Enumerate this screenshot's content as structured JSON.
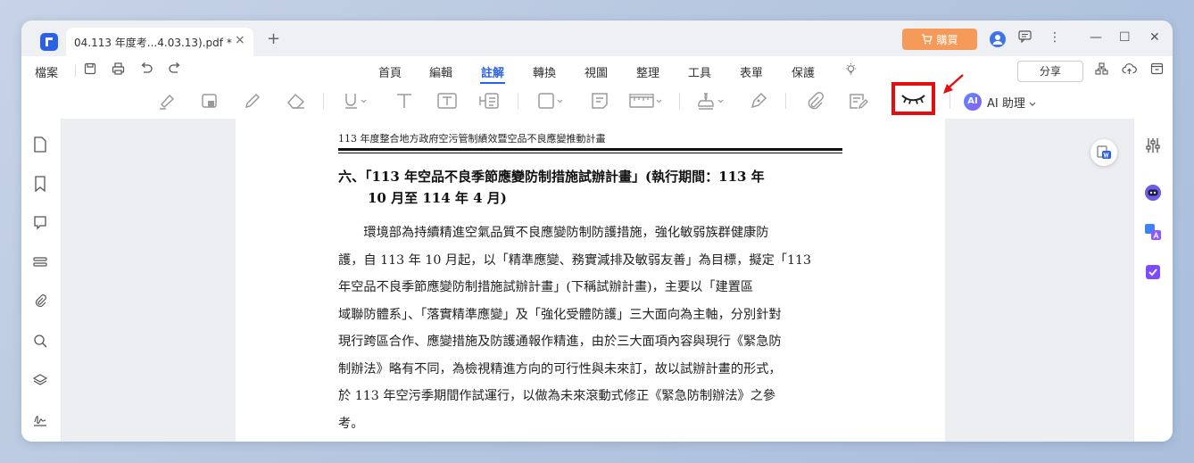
{
  "tab": {
    "title": "04.113 年度考...4.03.13).pdf *",
    "close": "×",
    "new": "+"
  },
  "titlebar": {
    "buy": "購買",
    "account_initial": "",
    "min": "—",
    "max": "☐",
    "close": "✕",
    "chat": "☰",
    "more": "⋮"
  },
  "menubar": {
    "file": "檔案",
    "items": [
      "首頁",
      "編輯",
      "註解",
      "轉換",
      "視圖",
      "整理",
      "工具",
      "表單",
      "保護"
    ],
    "active": "註解",
    "share": "分享"
  },
  "toolbar": {
    "ai_label": "AI 助理",
    "ai_icon_text": "AI",
    "highlight_color": "#e30e0e",
    "accent": "#2a61e8"
  },
  "page": {
    "header": "113 年度整合地方政府空污管制績效暨空品不良應變推動計畫",
    "heading_line1": "六、「113 年空品不良季節應變防制措施試辦計畫」(執行期間：113 年",
    "heading_line2": "10 月至 114 年 4 月)",
    "body_lines": [
      "　　環境部為持續精進空氣品質不良應變防制防護措施，強化敏弱族群健康防",
      "護，自 113 年 10 月起，以「精準應變、務實減排及敏弱友善」為目標，擬定「113",
      "年空品不良季節應變防制措施試辦計畫」(下稱試辦計畫)，主要以「建置區",
      "域聯防體系」、「落實精準應變」及「強化受體防護」三大面向為主軸，分別針對",
      "現行跨區合作、應變措施及防護通報作精進，由於三大面項內容與現行《緊急防",
      "制辦法》略有不同，為檢視精進方向的可行性與未來訂，故以試辦計畫的形式，",
      "於 113 年空污季期間作試運行，以做為未來滾動式修正《緊急防制辦法》之參",
      "考。"
    ]
  }
}
